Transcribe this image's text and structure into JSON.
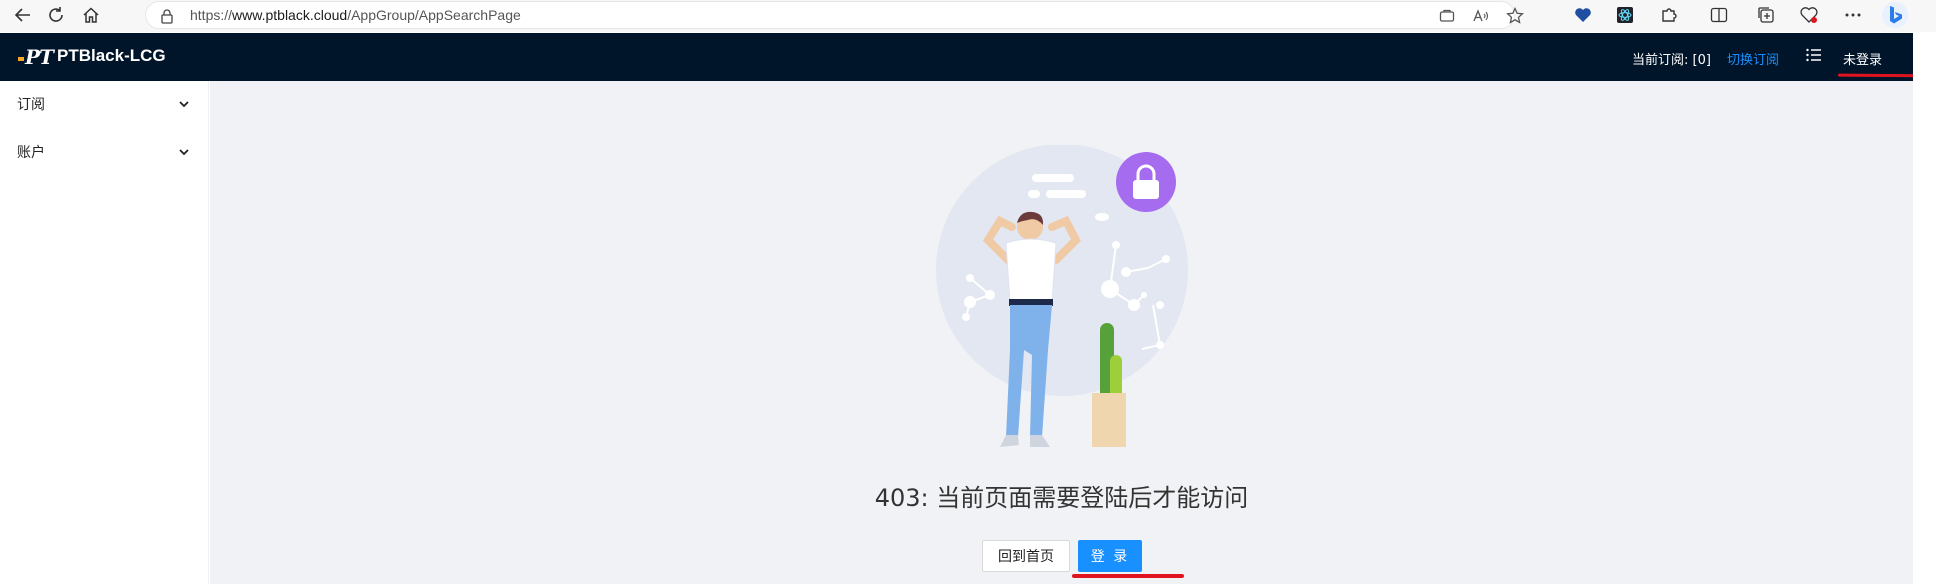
{
  "browser": {
    "url_prefix": "https://",
    "url_host": "www.ptblack.cloud",
    "url_path": "/AppGroup/AppSearchPage"
  },
  "header": {
    "logo_text": "PT",
    "app_title": "PTBlack-LCG",
    "current_subscription": "当前订阅: [0]",
    "switch_subscription": "切换订阅",
    "login_status": "未登录"
  },
  "sidebar": {
    "items": [
      {
        "label": "订阅"
      },
      {
        "label": "账户"
      }
    ]
  },
  "main": {
    "error_message": "403: 当前页面需要登陆后才能访问",
    "home_button": "回到首页",
    "login_button": "登 录"
  },
  "colors": {
    "header_bg": "#001529",
    "primary": "#1890ff",
    "content_bg": "#f0f2f5",
    "annotation_red": "#e0141e"
  }
}
